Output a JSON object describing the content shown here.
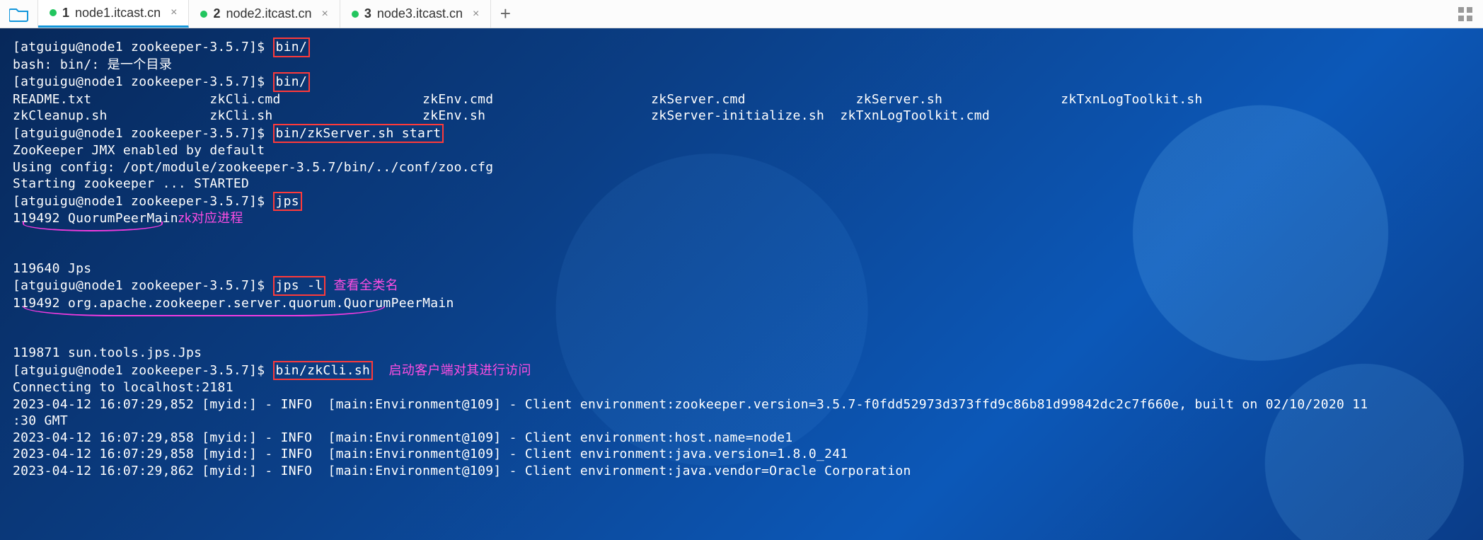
{
  "tabs": {
    "t1": {
      "num": "1",
      "label": "node1.itcast.cn"
    },
    "t2": {
      "num": "2",
      "label": "node2.itcast.cn"
    },
    "t3": {
      "num": "3",
      "label": "node3.itcast.cn"
    }
  },
  "icons": {
    "close": "×",
    "plus": "+"
  },
  "prompt": {
    "text": "[atguigu@node1 zookeeper-3.5.7]$ "
  },
  "cmd": {
    "bin1": "bin/",
    "bash_dir": "bash: bin/: 是一个目录",
    "bin2": "bin/",
    "start": "bin/zkServer.sh start",
    "jps": "jps",
    "jpsl": "jps -l",
    "cli": "bin/zkCli.sh"
  },
  "files": {
    "row1": "README.txt               zkCli.cmd                  zkEnv.cmd                    zkServer.cmd              zkServer.sh               zkTxnLogToolkit.sh",
    "row2": "zkCleanup.sh             zkCli.sh                   zkEnv.sh                     zkServer-initialize.sh  zkTxnLogToolkit.cmd"
  },
  "out": {
    "jmx": "ZooKeeper JMX enabled by default",
    "cfg": "Using config: /opt/module/zookeeper-3.5.7/bin/../conf/zoo.cfg",
    "started": "Starting zookeeper ... STARTED",
    "jps1": "119492 QuorumPeerMain",
    "jps2": "119640 Jps",
    "jpsl1": "119492 org.apache.zookeeper.server.quorum.QuorumPeerMain",
    "jpsl2": "119871 sun.tools.jps.Jps",
    "connecting": "Connecting to localhost:2181",
    "log1": "2023-04-12 16:07:29,852 [myid:] - INFO  [main:Environment@109] - Client environment:zookeeper.version=3.5.7-f0fdd52973d373ffd9c86b81d99842dc2c7f660e, built on 02/10/2020 11",
    "log1b": ":30 GMT",
    "log2": "2023-04-12 16:07:29,858 [myid:] - INFO  [main:Environment@109] - Client environment:host.name=node1",
    "log3": "2023-04-12 16:07:29,858 [myid:] - INFO  [main:Environment@109] - Client environment:java.version=1.8.0_241",
    "log4": "2023-04-12 16:07:29,862 [myid:] - INFO  [main:Environment@109] - Client environment:java.vendor=Oracle Corporation"
  },
  "annot": {
    "zk_proc": "zk对应进程",
    "full_name": "查看全类名",
    "start_cli": "启动客户端对其进行访问"
  }
}
